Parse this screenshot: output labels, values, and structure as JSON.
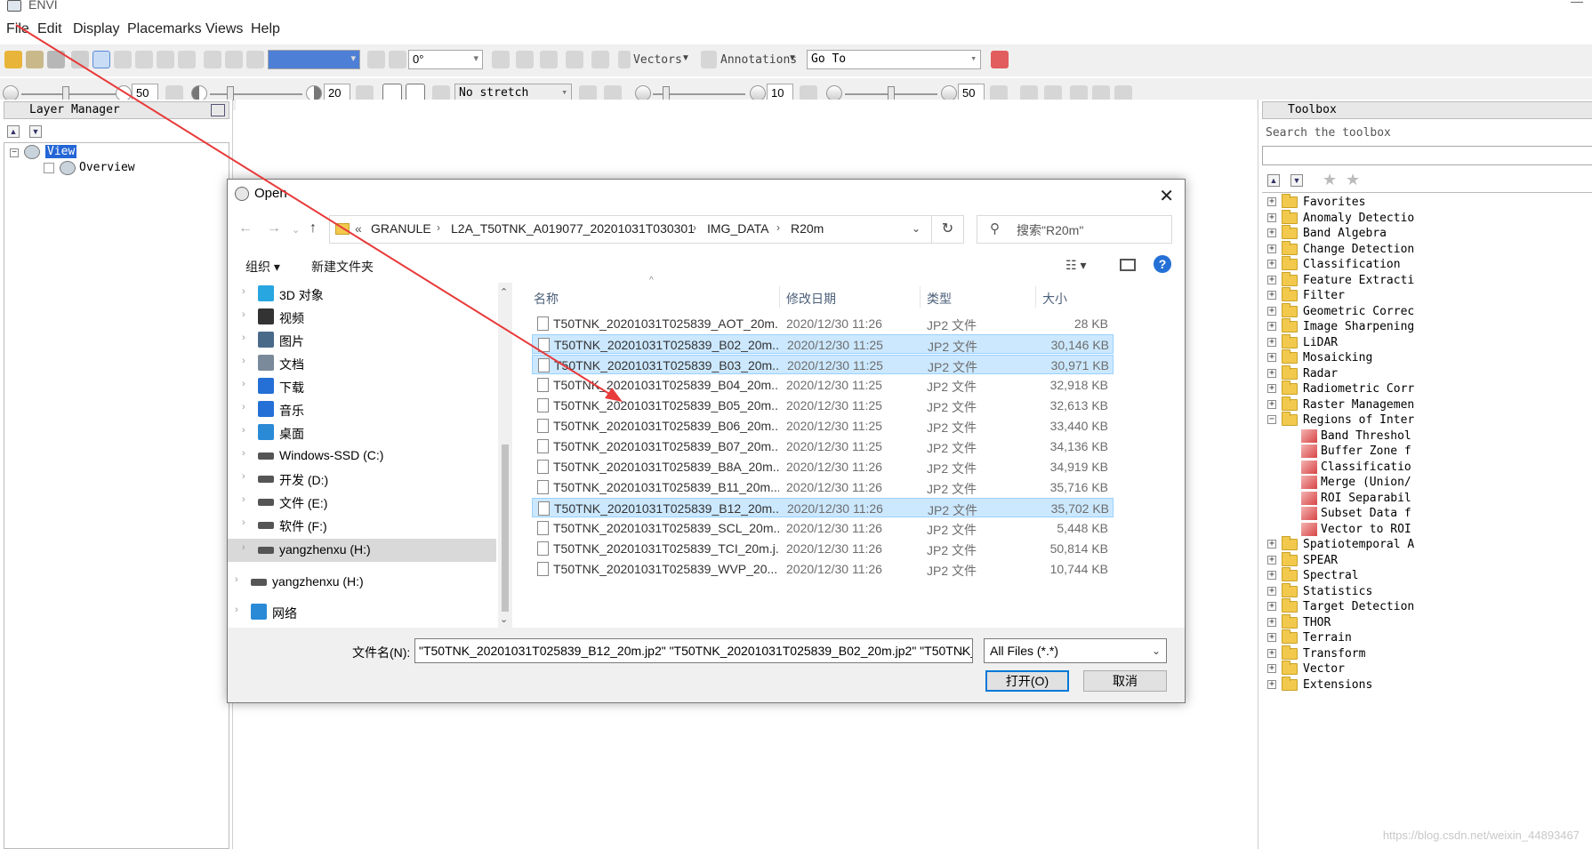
{
  "app": {
    "title": "ENVI"
  },
  "menu": [
    "File",
    "Edit",
    "Display",
    "Placemarks",
    "Views",
    "Help"
  ],
  "toolbar1": {
    "zoom_value": "",
    "rotation_value": "0°",
    "vectors_label": "Vectors",
    "annotations_label": "Annotations",
    "goto_label": "Go To"
  },
  "toolbar2": {
    "brightness": "50",
    "contrast": "20",
    "stretch_label": "No stretch",
    "sharpen": "10",
    "transparency": "50"
  },
  "layer_manager": {
    "title": "Layer Manager",
    "tree": {
      "view": "View",
      "overview": "Overview"
    }
  },
  "toolbox": {
    "title": "Toolbox",
    "search_placeholder": "Search the toolbox",
    "items": [
      "Favorites",
      "Anomaly Detectio",
      "Band Algebra",
      "Change Detection",
      "Classification",
      "Feature Extracti",
      "Filter",
      "Geometric Correc",
      "Image Sharpening",
      "LiDAR",
      "Mosaicking",
      "Radar",
      "Radiometric Corr",
      "Raster Managemen",
      "Regions of Inter"
    ],
    "roi_items": [
      "Band Threshol",
      "Buffer Zone f",
      "Classificatio",
      "Merge (Union/",
      "ROI Separabil",
      "Subset Data f",
      "Vector to ROI"
    ],
    "items_after": [
      "Spatiotemporal A",
      "SPEAR",
      "Spectral",
      "Statistics",
      "Target Detection",
      "THOR",
      "Terrain",
      "Transform",
      "Vector",
      "Extensions"
    ]
  },
  "dialog": {
    "title": "Open",
    "breadcrumb": [
      "GRANULE",
      "L2A_T50TNK_A019077_20201031T030301",
      "IMG_DATA",
      "R20m"
    ],
    "breadcrumb_prefix": "«",
    "search_placeholder": "搜索\"R20m\"",
    "organize": "组织 ▾",
    "new_folder": "新建文件夹",
    "nav_items": [
      {
        "label": "3D 对象",
        "icon": "3d-objects-icon",
        "color": "#27a6e0"
      },
      {
        "label": "视频",
        "icon": "video-icon",
        "color": "#333333"
      },
      {
        "label": "图片",
        "icon": "pictures-icon",
        "color": "#4a6a8a"
      },
      {
        "label": "文档",
        "icon": "documents-icon",
        "color": "#7a8a9a"
      },
      {
        "label": "下载",
        "icon": "downloads-icon",
        "color": "#2470d6"
      },
      {
        "label": "音乐",
        "icon": "music-icon",
        "color": "#2470d6"
      },
      {
        "label": "桌面",
        "icon": "desktop-icon",
        "color": "#2a8ad6"
      },
      {
        "label": "Windows-SSD (C:)",
        "icon": "system-drive-icon",
        "color": "#555555"
      },
      {
        "label": "开发 (D:)",
        "icon": "drive-icon",
        "color": "#555555"
      },
      {
        "label": "文件 (E:)",
        "icon": "drive-icon",
        "color": "#555555"
      },
      {
        "label": "软件 (F:)",
        "icon": "drive-icon",
        "color": "#555555"
      },
      {
        "label": "yangzhenxu (H:)",
        "icon": "drive-icon",
        "color": "#555555"
      },
      {
        "label": "yangzhenxu (H:)",
        "icon": "drive-icon",
        "color": "#555555"
      },
      {
        "label": "网络",
        "icon": "network-icon",
        "color": "#2a8ad6"
      }
    ],
    "columns": {
      "name": "名称",
      "date": "修改日期",
      "type": "类型",
      "size": "大小"
    },
    "files": [
      {
        "name": "T50TNK_20201031T025839_AOT_20m....",
        "date": "2020/12/30 11:26",
        "type": "JP2 文件",
        "size": "28 KB",
        "selected": false
      },
      {
        "name": "T50TNK_20201031T025839_B02_20m....",
        "date": "2020/12/30 11:25",
        "type": "JP2 文件",
        "size": "30,146 KB",
        "selected": true
      },
      {
        "name": "T50TNK_20201031T025839_B03_20m....",
        "date": "2020/12/30 11:25",
        "type": "JP2 文件",
        "size": "30,971 KB",
        "selected": true
      },
      {
        "name": "T50TNK_20201031T025839_B04_20m....",
        "date": "2020/12/30 11:25",
        "type": "JP2 文件",
        "size": "32,918 KB",
        "selected": false
      },
      {
        "name": "T50TNK_20201031T025839_B05_20m....",
        "date": "2020/12/30 11:25",
        "type": "JP2 文件",
        "size": "32,613 KB",
        "selected": false
      },
      {
        "name": "T50TNK_20201031T025839_B06_20m....",
        "date": "2020/12/30 11:25",
        "type": "JP2 文件",
        "size": "33,440 KB",
        "selected": false
      },
      {
        "name": "T50TNK_20201031T025839_B07_20m....",
        "date": "2020/12/30 11:25",
        "type": "JP2 文件",
        "size": "34,136 KB",
        "selected": false
      },
      {
        "name": "T50TNK_20201031T025839_B8A_20m....",
        "date": "2020/12/30 11:26",
        "type": "JP2 文件",
        "size": "34,919 KB",
        "selected": false
      },
      {
        "name": "T50TNK_20201031T025839_B11_20m....",
        "date": "2020/12/30 11:26",
        "type": "JP2 文件",
        "size": "35,716 KB",
        "selected": false
      },
      {
        "name": "T50TNK_20201031T025839_B12_20m....",
        "date": "2020/12/30 11:26",
        "type": "JP2 文件",
        "size": "35,702 KB",
        "selected": true
      },
      {
        "name": "T50TNK_20201031T025839_SCL_20m....",
        "date": "2020/12/30 11:26",
        "type": "JP2 文件",
        "size": "5,448 KB",
        "selected": false
      },
      {
        "name": "T50TNK_20201031T025839_TCI_20m.j...",
        "date": "2020/12/30 11:26",
        "type": "JP2 文件",
        "size": "50,814 KB",
        "selected": false
      },
      {
        "name": "T50TNK_20201031T025839_WVP_20...",
        "date": "2020/12/30 11:26",
        "type": "JP2 文件",
        "size": "10,744 KB",
        "selected": false
      }
    ],
    "filename_label": "文件名(N):",
    "filename_value": "\"T50TNK_20201031T025839_B12_20m.jp2\" \"T50TNK_20201031T025839_B02_20m.jp2\" \"T50TNK_",
    "filter_value": "All Files (*.*)",
    "open_button": "打开(O)",
    "cancel_button": "取消"
  },
  "watermark": "https://blog.csdn.net/weixin_44893467",
  "colors": {
    "accent": "#0078d7",
    "selection": "#cce8ff",
    "arrow": "#e83a3a"
  }
}
